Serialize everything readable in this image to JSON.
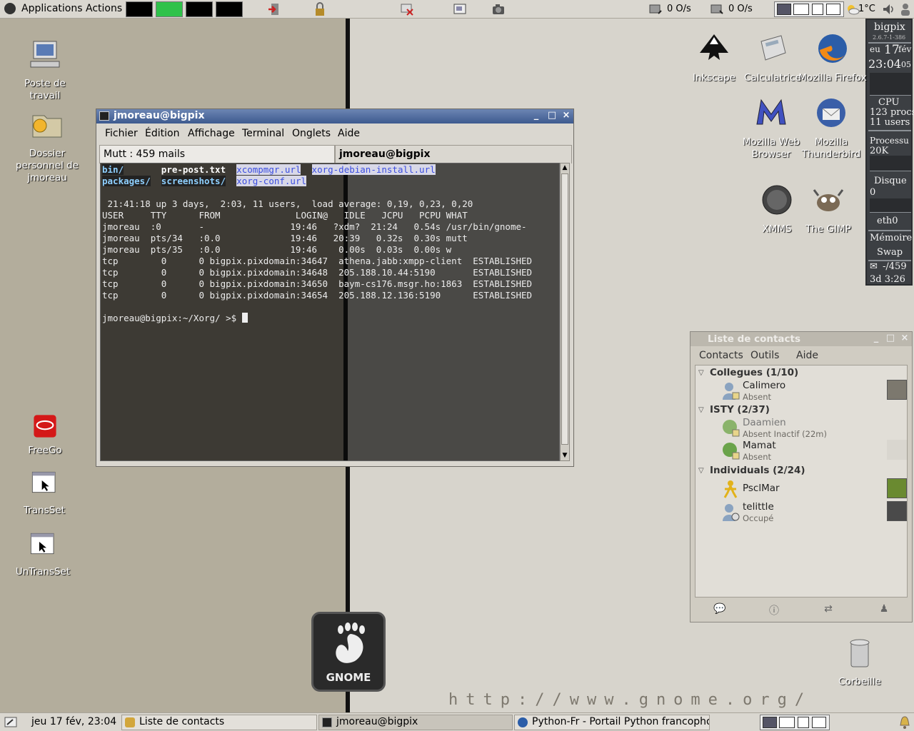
{
  "top_panel": {
    "applications": "Applications",
    "actions": "Actions",
    "net_in": "0 O/s",
    "net_out": "0 O/s",
    "weather": "1°C"
  },
  "gkrellm": {
    "host": "bigpix",
    "kernel": "2.6.7-1-386",
    "date_day": "eu",
    "date_num": "17",
    "date_month": "fév",
    "time": "23:04",
    "time_sec": "05",
    "cpu_label": "CPU",
    "procs": "123 procs",
    "users": "11 users",
    "proc_label": "Processu",
    "proc_val": "20K",
    "disk_label": "Disque",
    "disk_val": "0",
    "eth_label": "eth0",
    "mem_label": "Mémoire",
    "swap_label": "Swap",
    "mail": "-/459",
    "uptime": "3d 3:26"
  },
  "desktop_icons": [
    {
      "label": "Poste de travail"
    },
    {
      "label": "Dossier personnel de jmoreau"
    },
    {
      "label": "FreeGo"
    },
    {
      "label": "TransSet"
    },
    {
      "label": "UnTransSet"
    },
    {
      "label": "Inkscape"
    },
    {
      "label": "Calculatrice"
    },
    {
      "label": "Mozilla Firefox"
    },
    {
      "label": "Mozilla Web Browser"
    },
    {
      "label": "Mozilla Thunderbird"
    },
    {
      "label": "XMMS"
    },
    {
      "label": "The GIMP"
    },
    {
      "label": "Corbeille"
    }
  ],
  "gnome_logo_text": "GNOME",
  "gnome_url": "http://www.gnome.org/",
  "terminal": {
    "title": "jmoreau@bigpix",
    "menu": [
      "Fichier",
      "Édition",
      "Affichage",
      "Terminal",
      "Onglets",
      "Aide"
    ],
    "tab_inactive": "Mutt : 459 mails",
    "tab_active": "jmoreau@bigpix",
    "ls_row1": [
      "bin/",
      "pre-post.txt",
      "xcompmgr.url",
      "xorg-debian-install.url"
    ],
    "ls_row2": [
      "packages/",
      "screenshots/",
      "xorg-conf.url"
    ],
    "w_header": " 21:41:18 up 3 days,  2:03, 11 users,  load average: 0,19, 0,23, 0,20",
    "w_columns": "USER     TTY      FROM              LOGIN@   IDLE   JCPU   PCPU WHAT",
    "lines": [
      "jmoreau  :0       -                19:46   ?xdm?  21:24   0.54s /usr/bin/gnome-",
      "jmoreau  pts/34   :0.0             19:46   20:39   0.32s  0.30s mutt",
      "jmoreau  pts/35   :0.0             19:46    0.00s  0.03s  0.00s w",
      "tcp        0      0 bigpix.pixdomain:34647  athena.jabb:xmpp-client  ESTABLISHED",
      "tcp        0      0 bigpix.pixdomain:34648  205.188.10.44:5190       ESTABLISHED",
      "tcp        0      0 bigpix.pixdomain:34650  baym-cs176.msgr.ho:1863  ESTABLISHED",
      "tcp        0      0 bigpix.pixdomain:34654  205.188.12.136:5190      ESTABLISHED"
    ],
    "prompt": "jmoreau@bigpix:~/Xorg/ >$ "
  },
  "contacts": {
    "title": "Liste de contacts",
    "menu": [
      "Contacts",
      "Outils",
      "Aide"
    ],
    "groups": [
      {
        "name": "Collegues (1/10)"
      },
      {
        "name": "ISTY (2/37)"
      },
      {
        "name": "Individuals (2/24)"
      }
    ],
    "entries": [
      {
        "name": "Calimero",
        "status": "Absent"
      },
      {
        "name": "Daamien",
        "status": "Absent Inactif (22m)"
      },
      {
        "name": "Mamat",
        "status": "Absent"
      },
      {
        "name": "PsclMar",
        "status": ""
      },
      {
        "name": "telittle",
        "status": "Occupé"
      }
    ]
  },
  "bottom_panel": {
    "clock": "jeu 17 fév, 23:04",
    "tasks": [
      "Liste de contacts",
      "jmoreau@bigpix",
      "Python-Fr - Portail Python francophone"
    ]
  }
}
